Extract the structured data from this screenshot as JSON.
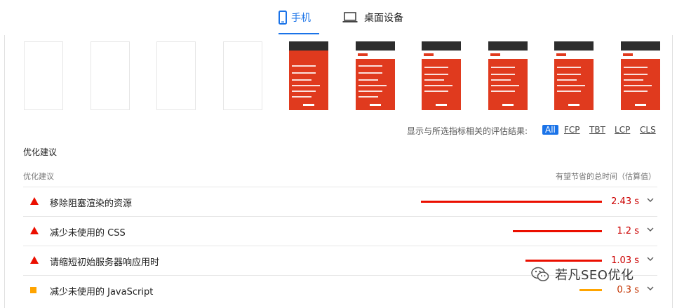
{
  "tabs": {
    "mobile": {
      "label": "手机",
      "icon": "mobile-phone-icon",
      "active": true
    },
    "desktop": {
      "label": "桌面设备",
      "icon": "laptop-icon",
      "active": false
    }
  },
  "filmstrip": {
    "frames": [
      "blank",
      "blank",
      "blank",
      "blank",
      "shot",
      "shot",
      "shot",
      "shot",
      "shot",
      "shot"
    ]
  },
  "filter": {
    "label": "显示与所选指标相关的评估结果:",
    "options": [
      "All",
      "FCP",
      "TBT",
      "LCP",
      "CLS"
    ],
    "selected": "All"
  },
  "section_title": "优化建议",
  "table_header": {
    "left": "优化建议",
    "right": "有望节省的总时间（估算值）"
  },
  "opportunities": [
    {
      "title": "移除阻塞渲染的资源",
      "value": "2.43 s",
      "savings_seconds": 2.43,
      "severity": "fail",
      "color": "#eb0f00"
    },
    {
      "title": "减少未使用的 CSS",
      "value": "1.2 s",
      "savings_seconds": 1.2,
      "severity": "fail",
      "color": "#eb0f00"
    },
    {
      "title": "请缩短初始服务器响应用时",
      "value": "1.03 s",
      "savings_seconds": 1.03,
      "severity": "fail",
      "color": "#eb0f00"
    },
    {
      "title": "减少未使用的 JavaScript",
      "value": "0.3 s",
      "savings_seconds": 0.3,
      "severity": "average",
      "color": "#ffa400"
    }
  ],
  "watermark": {
    "text": "若凡SEO优化",
    "icon": "wechat-icon"
  },
  "colors": {
    "accent": "#1a73e8",
    "fail": "#eb0f00",
    "average": "#ffa400",
    "brand_red": "#e03a1e"
  }
}
